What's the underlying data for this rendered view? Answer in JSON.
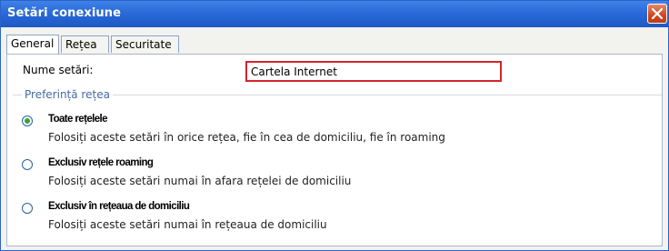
{
  "window": {
    "title": "Setări conexiune"
  },
  "tabs": [
    {
      "label": "General",
      "active": true
    },
    {
      "label": "Rețea",
      "active": false
    },
    {
      "label": "Securitate",
      "active": false
    }
  ],
  "settings_name": {
    "label": "Nume setări:",
    "value": "Cartela Internet"
  },
  "network_preference": {
    "legend": "Preferință rețea",
    "selected_index": 0,
    "options": [
      {
        "title": "Toate rețelele",
        "description": "Folosiți aceste setări în orice rețea, fie în cea de domiciliu, fie în roaming"
      },
      {
        "title": "Exclusiv rețele roaming",
        "description": "Folosiți aceste setări numai în afara rețelei de domiciliu"
      },
      {
        "title": "Exclusiv în rețeaua de domiciliu",
        "description": "Folosiți aceste setări numai în rețeaua de domiciliu"
      }
    ]
  },
  "colors": {
    "titlebar": "#2a6ad8",
    "highlight_border": "#d4242b",
    "legend_text": "#456aa6",
    "radio_selected": "#3aa03a"
  }
}
